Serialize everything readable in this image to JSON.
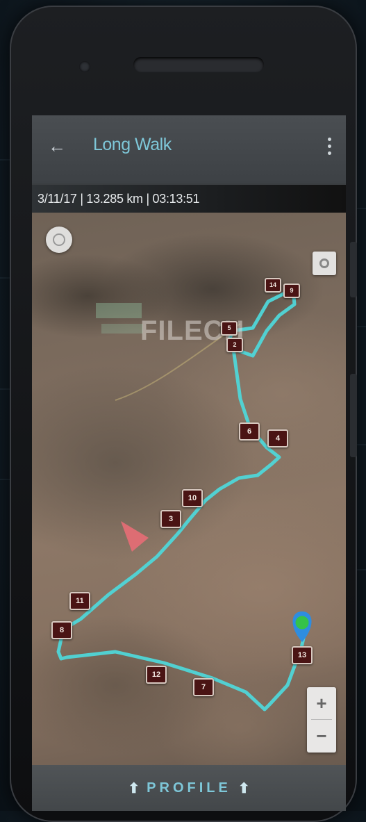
{
  "app": {
    "title": "Long Walk",
    "info": "3/11/17 | 13.285 km | 03:13:51"
  },
  "icons": {
    "back": "arrow-left-icon",
    "menu": "more-vertical-icon",
    "compass": "compass-icon",
    "locate": "my-location-icon",
    "start": "start-pin-icon",
    "direction": "direction-arrow-icon"
  },
  "map": {
    "label": "FILECH",
    "markers": [
      "14",
      "9",
      "5",
      "2",
      "6",
      "4",
      "10",
      "3",
      "11",
      "8",
      "12",
      "7",
      "13"
    ]
  },
  "zoom": {
    "in_label": "+",
    "out_label": "−"
  },
  "footer": {
    "profile_label": "PROFILE",
    "arrow": "⬆"
  },
  "colors": {
    "accent": "#7ec7d8",
    "track": "#4fd6d8",
    "marker_bg": "#4a1414",
    "start_dot": "#35c24a",
    "arrow": "#e76d76"
  }
}
